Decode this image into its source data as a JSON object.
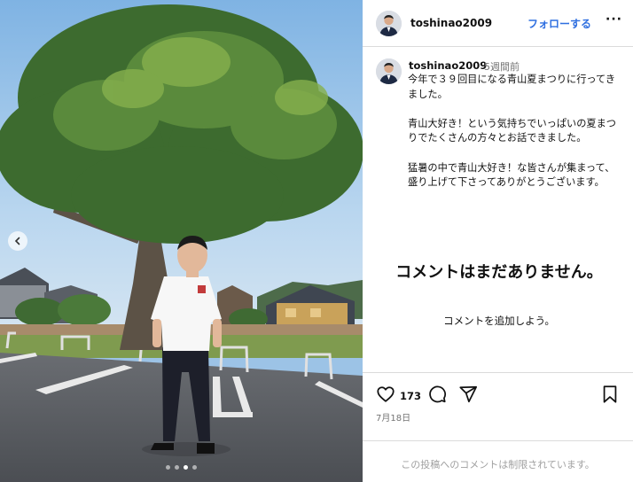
{
  "post": {
    "author": "toshinao2009",
    "follow_label": "フォローする",
    "more_label": "···",
    "time_ago": "5週間前",
    "caption": [
      "今年で３９回目になる青山夏まつりに行ってきました。",
      "青山大好き！という気持ちでいっぱいの夏まつりでたくさんの方々とお話できました。",
      "猛暑の中で青山大好き！な皆さんが集まって、盛り上げて下さってありがとうございます。"
    ],
    "no_comments_title": "コメントはまだありません。",
    "add_comment_prompt": "コメントを追加しよう。",
    "like_count": "173",
    "date": "7月18日",
    "comments_restricted": "この投稿へのコメントは制限されています。"
  },
  "carousel": {
    "slide_count": 4,
    "active_index": 2
  },
  "icons": {
    "prev": "chevron-left-icon",
    "like": "heart-icon",
    "comment": "comment-icon",
    "share": "send-icon",
    "save": "bookmark-icon"
  },
  "colors": {
    "follow": "#2f6fe0",
    "secondary_text": "#737373",
    "divider": "#dbdbdb"
  }
}
